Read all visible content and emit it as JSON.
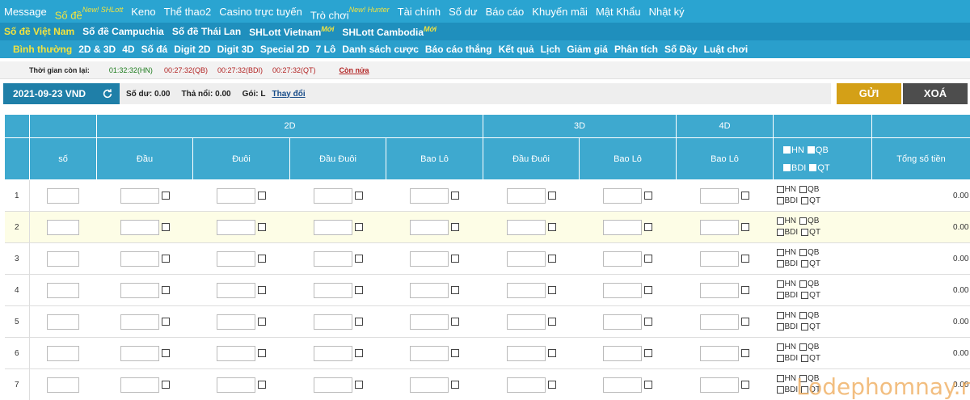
{
  "topnav": [
    {
      "label": "Message",
      "badge": ""
    },
    {
      "label": "Số đề",
      "badge": "New! SHLott",
      "active": true
    },
    {
      "label": "Keno",
      "badge": ""
    },
    {
      "label": "Thể thao2",
      "badge": ""
    },
    {
      "label": "Casino trực tuyến",
      "badge": ""
    },
    {
      "label": "Trò chơi",
      "badge": "New! Hunter"
    },
    {
      "label": "Tài chính",
      "badge": ""
    },
    {
      "label": "Số dư",
      "badge": ""
    },
    {
      "label": "Báo cáo",
      "badge": ""
    },
    {
      "label": "Khuyến mãi",
      "badge": ""
    },
    {
      "label": "Mật Khẩu",
      "badge": ""
    },
    {
      "label": "Nhật ký",
      "badge": ""
    }
  ],
  "subnav1": [
    {
      "label": "Số đề Việt Nam",
      "badge": "",
      "active": true
    },
    {
      "label": "Số đề Campuchia",
      "badge": ""
    },
    {
      "label": "Số đề Thái Lan",
      "badge": ""
    },
    {
      "label": "SHLott Vietnam",
      "badge": "Mới"
    },
    {
      "label": "SHLott Cambodia",
      "badge": "Mới"
    }
  ],
  "subnav2": [
    {
      "label": "Bình thường",
      "active": true
    },
    {
      "label": "2D & 3D"
    },
    {
      "label": "4D"
    },
    {
      "label": "Số đá"
    },
    {
      "label": "Digit 2D"
    },
    {
      "label": "Digit 3D"
    },
    {
      "label": "Special 2D"
    },
    {
      "label": "7 Lô"
    },
    {
      "label": "Danh sách cược"
    },
    {
      "label": "Báo cáo thắng"
    },
    {
      "label": "Kết quả"
    },
    {
      "label": "Lịch"
    },
    {
      "label": "Giảm giá"
    },
    {
      "label": "Phân tích"
    },
    {
      "label": "Số Đầy"
    },
    {
      "label": "Luật chơi"
    }
  ],
  "timer": {
    "label": "Thời gian còn lại:",
    "hn": "01:32:32(HN)",
    "qb": "00:27:32(QB)",
    "bdi": "00:27:32(BDI)",
    "qt": "00:27:32(QT)",
    "more": "Còn nửa"
  },
  "datebar": {
    "date": "2021-09-23 VND",
    "balance": "Số dư: 0.00",
    "float": "Thả nổi: 0.00",
    "package": "Gói: L",
    "change": "Thay đổi",
    "send": "GỬI",
    "delete": "XOÁ"
  },
  "table": {
    "groups": {
      "g2d": "2D",
      "g3d": "3D",
      "g4d": "4D"
    },
    "columns": {
      "so": "số",
      "dau": "Đầu",
      "duoi": "Đuôi",
      "dauduoi2d": "Đầu Đuôi",
      "baolo2d": "Bao Lô",
      "dauduoi3d": "Đầu Đuôi",
      "baolo3d": "Bao Lô",
      "baolo4d": "Bao Lô",
      "total": "Tổng số tiền"
    },
    "regions": {
      "hn": "HN",
      "qb": "QB",
      "bdi": "BDI",
      "qt": "QT"
    },
    "rows": [
      {
        "n": "1",
        "total": "0.00"
      },
      {
        "n": "2",
        "total": "0.00"
      },
      {
        "n": "3",
        "total": "0.00"
      },
      {
        "n": "4",
        "total": "0.00"
      },
      {
        "n": "5",
        "total": "0.00"
      },
      {
        "n": "6",
        "total": "0.00"
      },
      {
        "n": "7",
        "total": "0.00"
      }
    ]
  },
  "watermark": "Lodephomnay.net",
  "colors": {
    "nav": "#2aa4d1",
    "active": "#f3e33e",
    "header": "#3ea9cf",
    "send": "#d4a017",
    "delete": "#4d4d4d",
    "highlight_row": "#fdfde6"
  }
}
